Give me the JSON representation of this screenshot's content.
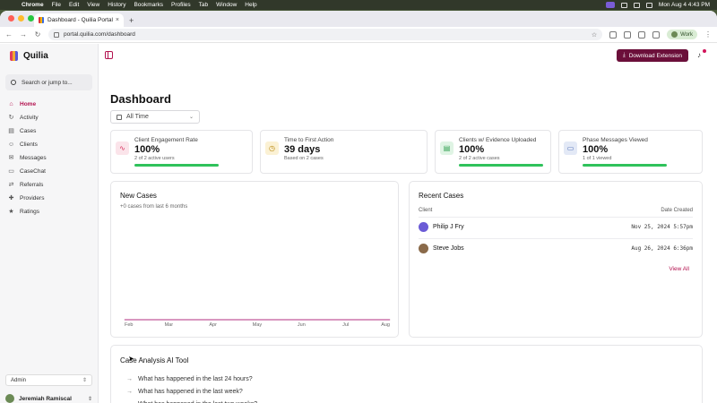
{
  "menubar": {
    "app": "Chrome",
    "items": [
      "File",
      "Edit",
      "View",
      "History",
      "Bookmarks",
      "Profiles",
      "Tab",
      "Window",
      "Help"
    ],
    "clock": "Mon Aug 4  4:43 PM"
  },
  "browser": {
    "tab_title": "Dashboard - Quilia Portal",
    "url": "portal.quilia.com/dashboard",
    "profile": "Work"
  },
  "sidebar": {
    "brand": "Quilia",
    "search_placeholder": "Search or jump to...",
    "items": [
      {
        "label": "Home",
        "icon": "home-icon",
        "glyph": "⌂",
        "active": true
      },
      {
        "label": "Activity",
        "icon": "activity-icon",
        "glyph": "↻",
        "active": false
      },
      {
        "label": "Cases",
        "icon": "cases-icon",
        "glyph": "▤",
        "active": false
      },
      {
        "label": "Clients",
        "icon": "clients-icon",
        "glyph": "☺",
        "active": false
      },
      {
        "label": "Messages",
        "icon": "messages-icon",
        "glyph": "✉",
        "active": false
      },
      {
        "label": "CaseChat",
        "icon": "casechat-icon",
        "glyph": "▭",
        "active": false
      },
      {
        "label": "Referrals",
        "icon": "referrals-icon",
        "glyph": "⇄",
        "active": false
      },
      {
        "label": "Providers",
        "icon": "providers-icon",
        "glyph": "✚",
        "active": false
      },
      {
        "label": "Ratings",
        "icon": "ratings-icon",
        "glyph": "★",
        "active": false
      }
    ],
    "role": "Admin",
    "user": "Jeremiah Ramiscal"
  },
  "header": {
    "download_label": "Download Extension"
  },
  "page": {
    "title": "Dashboard",
    "time_filter": "All Time"
  },
  "stats": [
    {
      "label": "Client Engagement Rate",
      "value": "100%",
      "sub": "2 of 2 active users",
      "icon": "activity-icon",
      "color": "#d9345f",
      "bg": "#fbe4ea",
      "progress": 1.0
    },
    {
      "label": "Time to First Action",
      "value": "39 days",
      "sub": "Based on 2 cases",
      "icon": "clock-icon",
      "color": "#b8860b",
      "bg": "#fbf1d4",
      "progress": null
    },
    {
      "label": "Clients w/ Evidence Uploaded",
      "value": "100%",
      "sub": "2 of 2 active cases",
      "icon": "document-icon",
      "color": "#2e9e4f",
      "bg": "#dff4e4",
      "progress": 1.0
    },
    {
      "label": "Phase Messages Viewed",
      "value": "100%",
      "sub": "1 of 1 viewed",
      "icon": "message-icon",
      "color": "#4a6bb5",
      "bg": "#e3e9f6",
      "progress": 1.0
    }
  ],
  "new_cases": {
    "title": "New Cases",
    "subtitle": "+0 cases from last 6 months"
  },
  "chart_data": {
    "type": "line",
    "categories": [
      "Feb",
      "Mar",
      "Apr",
      "May",
      "Jun",
      "Jul",
      "Aug"
    ],
    "series": [
      {
        "values": [
          0,
          0,
          0,
          0,
          0,
          0,
          0
        ],
        "color": "#c2599a"
      }
    ],
    "ylim": [
      0,
      1
    ],
    "grid": false
  },
  "recent_cases": {
    "title": "Recent Cases",
    "col_client": "Client",
    "col_date": "Date Created",
    "rows": [
      {
        "name": "Philip J Fry",
        "date": "Nov 25, 2024 5:57pm"
      },
      {
        "name": "Steve Jobs",
        "date": "Aug 26, 2024 6:36pm"
      }
    ],
    "view_all": "View All"
  },
  "ai_tool": {
    "title": "Case Analysis AI Tool",
    "questions": [
      "What has happened in the last 24 hours?",
      "What has happened in the last week?",
      "What has happened in the last two weeks?"
    ]
  }
}
